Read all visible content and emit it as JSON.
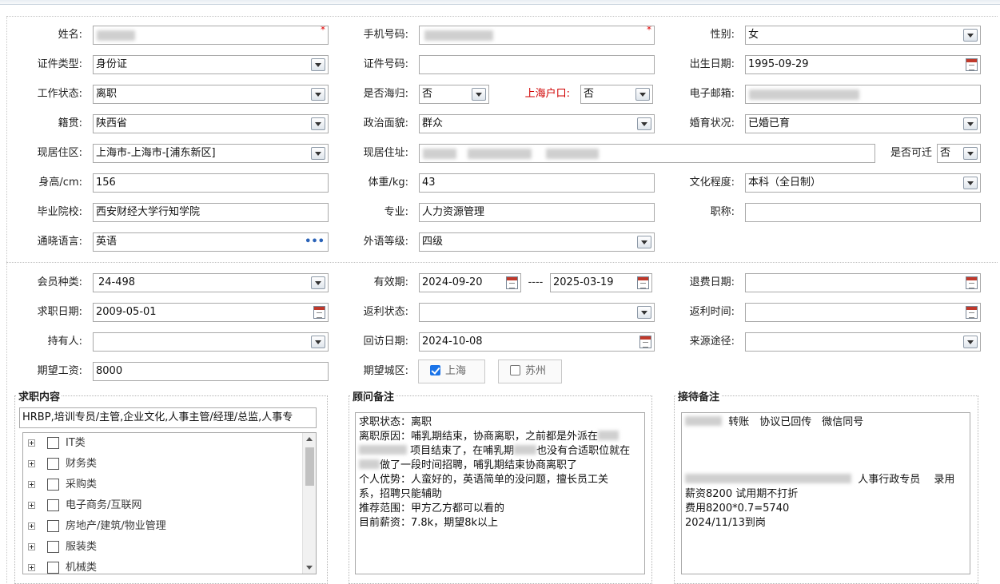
{
  "section1": {
    "name": {
      "label": "姓名:",
      "value": ""
    },
    "mobile": {
      "label": "手机号码:",
      "value": ""
    },
    "gender": {
      "label": "性别:",
      "value": "女"
    },
    "id_type": {
      "label": "证件类型:",
      "value": "身份证"
    },
    "id_number": {
      "label": "证件号码:",
      "value": ""
    },
    "birth_date": {
      "label": "出生日期:",
      "value": "1995-09-29"
    },
    "work_status": {
      "label": "工作状态:",
      "value": "离职"
    },
    "returnee": {
      "label": "是否海归:",
      "value": "否"
    },
    "shanghai_hukou": {
      "label": "上海户口:",
      "value": "否"
    },
    "email": {
      "label": "电子邮箱:",
      "value": ""
    },
    "native_place": {
      "label": "籍贯:",
      "value": "陕西省"
    },
    "political_status": {
      "label": "政治面貌:",
      "value": "群众"
    },
    "marital_status": {
      "label": "婚育状况:",
      "value": "已婚已育"
    },
    "residence_area": {
      "label": "现居住区:",
      "value": "上海市-上海市-[浦东新区]"
    },
    "residence_address": {
      "label": "现居住址:",
      "value": ""
    },
    "relocatable": {
      "label": "是否可迁",
      "value": "否"
    },
    "height": {
      "label": "身高/cm:",
      "value": "156"
    },
    "weight": {
      "label": "体重/kg:",
      "value": "43"
    },
    "education": {
      "label": "文化程度:",
      "value": "本科（全日制）"
    },
    "school": {
      "label": "毕业院校:",
      "value": "西安财经大学行知学院"
    },
    "major": {
      "label": "专业:",
      "value": "人力资源管理"
    },
    "title": {
      "label": "职称:",
      "value": ""
    },
    "language": {
      "label": "通晓语言:",
      "value": "英语"
    },
    "language_level": {
      "label": "外语等级:",
      "value": "四级"
    }
  },
  "section2": {
    "member_type": {
      "label": "会员种类:",
      "value": "24-498"
    },
    "validity": {
      "label": "有效期:",
      "start": "2024-09-20",
      "separator": "----",
      "end": "2025-03-19"
    },
    "refund_date": {
      "label": "退费日期:",
      "value": ""
    },
    "job_seek_date": {
      "label": "求职日期:",
      "value": "2009-05-01"
    },
    "rebate_status": {
      "label": "返利状态:",
      "value": ""
    },
    "rebate_time": {
      "label": "返利时间:",
      "value": ""
    },
    "holder": {
      "label": "持有人:",
      "value": ""
    },
    "visit_date": {
      "label": "回访日期:",
      "value": "2024-10-08"
    },
    "source": {
      "label": "来源途径:",
      "value": ""
    },
    "expected_salary": {
      "label": "期望工资:",
      "value": "8000"
    },
    "expected_city": {
      "label": "期望城区:",
      "options": [
        {
          "label": "上海",
          "checked": true
        },
        {
          "label": "苏州",
          "checked": false
        }
      ]
    }
  },
  "job_content": {
    "legend": "求职内容",
    "summary": "HRBP,培训专员/主管,企业文化,人事主管/经理/总监,人事专",
    "categories": [
      "IT类",
      "财务类",
      "采购类",
      "电子商务/互联网",
      "房地产/建筑/物业管理",
      "服装类",
      "机械类"
    ]
  },
  "consultant_notes": {
    "legend": "顾问备注",
    "lines": [
      {
        "pre": "求职状态：离职",
        "post": ""
      },
      {
        "pre": "离职原因：哺乳期结束，协商离职，之前都是外派在",
        "post": ""
      },
      {
        "pre": "",
        "post": " 项目结束了，在哺乳期"
      },
      {
        "pre": "",
        "post": "也没有合适职位就在"
      },
      {
        "pre": "",
        "post": "做了一段时间招聘，哺乳期结束协商离职了"
      },
      {
        "pre": "个人优势：人蛮好的，英语简单的没问题，擅长员工关",
        "post": ""
      },
      {
        "pre": "系，招聘只能辅助",
        "post": ""
      },
      {
        "pre": "推荐范围：甲方乙方都可以看的",
        "post": ""
      },
      {
        "pre": "目前薪资：7.8k，期望8k以上",
        "post": ""
      }
    ]
  },
  "reception_notes": {
    "legend": "接待备注",
    "line1": "转账　协议已回传　微信同号",
    "line2": "人事行政专员　 录用",
    "line3": "薪资8200 试用期不打折",
    "line4": "费用8200*0.7=5740",
    "line5": "2024/11/13到岗"
  }
}
